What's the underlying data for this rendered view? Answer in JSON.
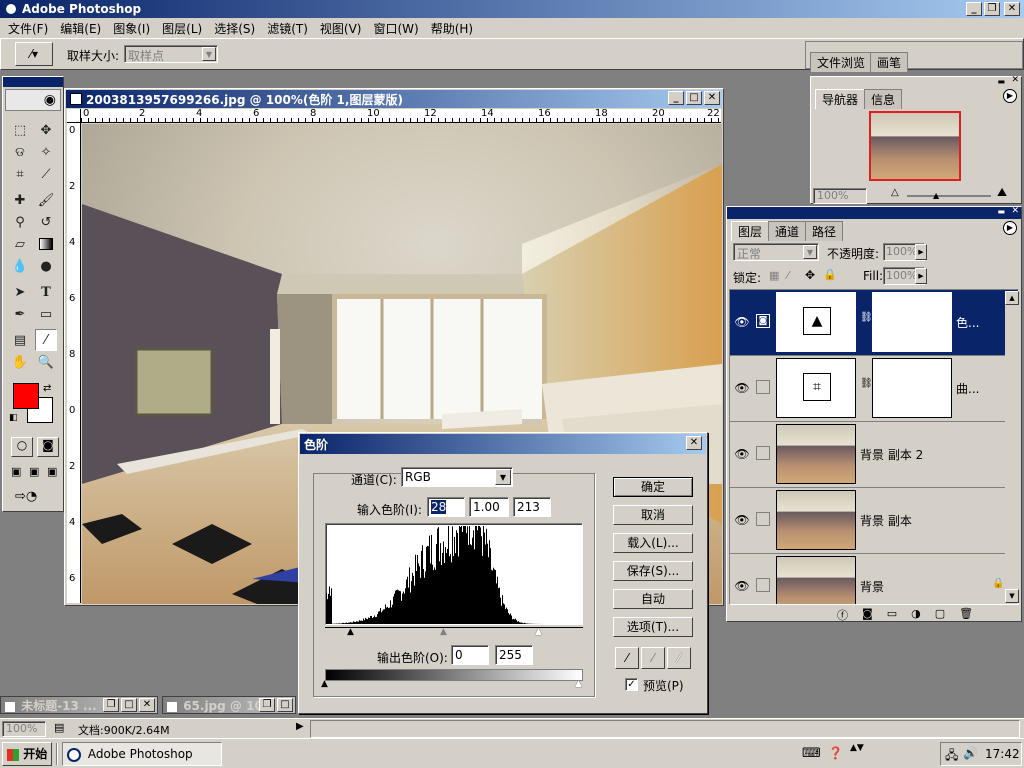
{
  "app": {
    "title": "Adobe Photoshop"
  },
  "menu": [
    "文件(F)",
    "编辑(E)",
    "图象(I)",
    "图层(L)",
    "选择(S)",
    "滤镜(T)",
    "视图(V)",
    "窗口(W)",
    "帮助(H)"
  ],
  "options_bar": {
    "sample_size_label": "取样大小:",
    "sample_size_value": "取样点",
    "file_browser": "文件浏览",
    "brushes": "画笔"
  },
  "document": {
    "title": "2003813957699266.jpg @ 100%(色阶 1,图层蒙版)",
    "ruler_top": [
      "0",
      "2",
      "4",
      "6",
      "8",
      "10",
      "12",
      "14",
      "16",
      "18",
      "20",
      "22"
    ],
    "ruler_left": [
      "0",
      "2",
      "4",
      "6",
      "8",
      "0",
      "2",
      "4",
      "6"
    ]
  },
  "navigator": {
    "tab_navigator": "导航器",
    "tab_info": "信息",
    "zoom": "100%"
  },
  "layers_panel": {
    "tabs": [
      "图层",
      "通道",
      "路径"
    ],
    "blend_mode": "正常",
    "opacity_label": "不透明度:",
    "opacity": "100%",
    "lock_label": "锁定:",
    "fill_label": "Fill:",
    "fill": "100%",
    "layers": [
      {
        "name": "色...",
        "selected": true
      },
      {
        "name": "曲...",
        "selected": false
      },
      {
        "name": "背景 副本 2",
        "selected": false
      },
      {
        "name": "背景 副本",
        "selected": false
      },
      {
        "name": "背景",
        "selected": false
      }
    ]
  },
  "levels_dialog": {
    "title": "色阶",
    "channel_label": "通道(C):",
    "channel_value": "RGB",
    "input_label": "输入色阶(I):",
    "input_black": "28",
    "input_gamma": "1.00",
    "input_white": "213",
    "output_label": "输出色阶(O):",
    "output_black": "0",
    "output_white": "255",
    "buttons": {
      "ok": "确定",
      "cancel": "取消",
      "load": "载入(L)...",
      "save": "保存(S)...",
      "auto": "自动",
      "options": "选项(T)..."
    },
    "preview_label": "预览(P)",
    "preview_checked": true
  },
  "minimized": [
    {
      "title": "未标题-13 ..."
    },
    {
      "title": "65.jpg @ 10..."
    }
  ],
  "status": {
    "zoom": "100%",
    "doc_size": "文档:900K/2.64M"
  },
  "taskbar": {
    "start": "开始",
    "app": "Adobe Photoshop",
    "clock": "17:42"
  }
}
